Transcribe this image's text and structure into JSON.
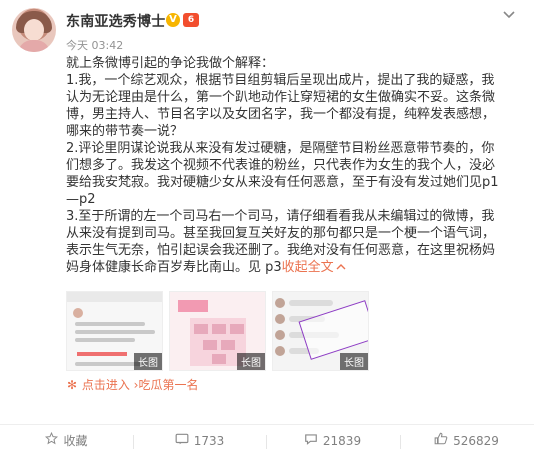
{
  "header": {
    "author": "东南亚选秀博士",
    "verified_badge": "V",
    "level_badge": "6",
    "time": "今天 03:42",
    "more_icon": "chevron-down-icon"
  },
  "post": {
    "lines": [
      "就上条微博引起的争论我做个解释：",
      "1.我，一个综艺观众，根据节目组剪辑后呈现出成片，提出了我的疑惑，我认为无论理由是什么，第一个趴地动作让穿短裙的女生做确实不妥。这条微博，男主持人、节目名字以及女团名字，我一个都没有提，纯粹发表感想，哪来的带节奏一说？",
      "2.评论里阴谋论说我从来没有发过硬糖，是隔壁节目粉丝恶意带节奏的，你们想多了。我发这个视频不代表谁的粉丝，只代表作为女生的我个人，没必要给我安梵寂。我对硬糖少女从来没有任何恶意，至于有没有发过她们见p1—p2",
      "3.至于所谓的左一个司马右一个司马，请仔细看看我从未编辑过的微博，我从来没有提到司马。甚至我回复互关好友的那句都只是一个梗一个语气词，表示生气无奈，怕引起误会我还删了。我绝对没有任何恶意，在这里祝杨妈妈身体健康长命百岁寿比南山。见 p3"
    ],
    "expand_label": "收起全文",
    "expand_icon": "chevron-up-icon"
  },
  "thumbnails": [
    {
      "tag": "长图"
    },
    {
      "tag": "长图"
    },
    {
      "tag": "长图"
    }
  ],
  "topic": {
    "icon": "flower-icon",
    "label": "点击进入 ›吃瓜第一名"
  },
  "footer": {
    "favorite": {
      "icon": "star-icon",
      "label": "收藏"
    },
    "repost": {
      "icon": "repost-icon",
      "count": "1733"
    },
    "comment": {
      "icon": "comment-icon",
      "count": "21839"
    },
    "like": {
      "icon": "thumbs-up-icon",
      "count": "526829"
    }
  }
}
